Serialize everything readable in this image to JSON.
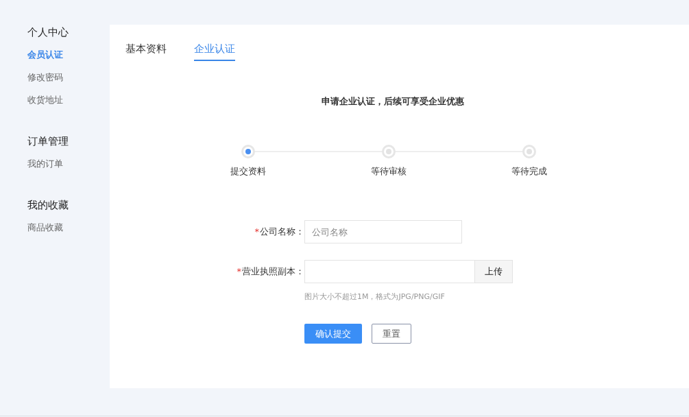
{
  "sidebar": {
    "groups": [
      {
        "title": "个人中心",
        "items": [
          {
            "label": "会员认证",
            "selected": true
          },
          {
            "label": "修改密码",
            "selected": false
          },
          {
            "label": "收货地址",
            "selected": false
          }
        ]
      },
      {
        "title": "订单管理",
        "items": [
          {
            "label": "我的订单",
            "selected": false
          }
        ]
      },
      {
        "title": "我的收藏",
        "items": [
          {
            "label": "商品收藏",
            "selected": false
          }
        ]
      }
    ]
  },
  "tabs": [
    {
      "label": "基本资料",
      "selected": false
    },
    {
      "label": "企业认证",
      "selected": true
    }
  ],
  "heading": "申请企业认证，后续可享受企业优惠",
  "steps": [
    {
      "label": "提交资料",
      "active": true
    },
    {
      "label": "等待审核",
      "active": false
    },
    {
      "label": "等待完成",
      "active": false
    }
  ],
  "form": {
    "fields": [
      {
        "kind": "text",
        "required_mark": "*",
        "label": "公司名称：",
        "placeholder": "公司名称"
      },
      {
        "kind": "upload",
        "required_mark": "*",
        "label": "营业执照副本：",
        "button": "上传",
        "hint": "图片大小不超过1M，格式为JPG/PNG/GIF"
      }
    ],
    "submit": "确认提交",
    "reset": "重置"
  }
}
